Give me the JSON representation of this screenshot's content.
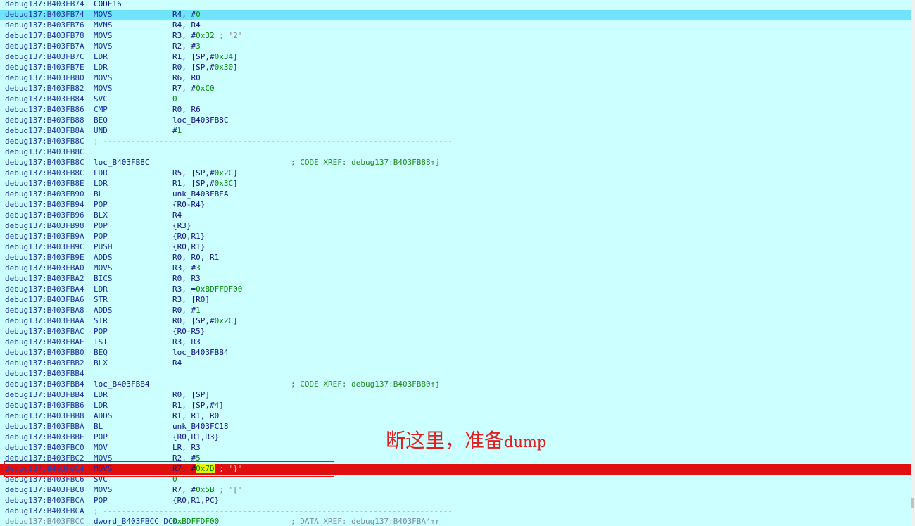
{
  "listing": [
    {
      "addr": "debug137:B403FB74",
      "label": "CODE16"
    },
    {
      "addr": "debug137:B403FB74",
      "mn": "MOVS",
      "ops": [
        [
          "R4, #",
          ""
        ],
        [
          "0",
          "num"
        ]
      ],
      "state": "hl"
    },
    {
      "addr": "debug137:B403FB76",
      "mn": "MVNS",
      "ops": [
        [
          "R4, R4",
          ""
        ]
      ]
    },
    {
      "addr": "debug137:B403FB78",
      "mn": "MOVS",
      "ops": [
        [
          "R3, #",
          ""
        ],
        [
          "0x32",
          "num"
        ],
        [
          " ; '2'",
          "cm"
        ]
      ]
    },
    {
      "addr": "debug137:B403FB7A",
      "mn": "MOVS",
      "ops": [
        [
          "R2, #",
          ""
        ],
        [
          "3",
          "num"
        ]
      ]
    },
    {
      "addr": "debug137:B403FB7C",
      "mn": "LDR",
      "ops": [
        [
          "R1, [SP,#",
          ""
        ],
        [
          "0x34",
          "num"
        ],
        [
          "]",
          ""
        ]
      ]
    },
    {
      "addr": "debug137:B403FB7E",
      "mn": "LDR",
      "ops": [
        [
          "R0, [SP,#",
          ""
        ],
        [
          "0x30",
          "num"
        ],
        [
          "]",
          ""
        ]
      ]
    },
    {
      "addr": "debug137:B403FB80",
      "mn": "MOVS",
      "ops": [
        [
          "R6, R0",
          ""
        ]
      ]
    },
    {
      "addr": "debug137:B403FB82",
      "mn": "MOVS",
      "ops": [
        [
          "R7, #",
          ""
        ],
        [
          "0xC0",
          "num"
        ]
      ]
    },
    {
      "addr": "debug137:B403FB84",
      "mn": "SVC",
      "ops": [
        [
          "0",
          "num"
        ]
      ]
    },
    {
      "addr": "debug137:B403FB86",
      "mn": "CMP",
      "ops": [
        [
          "R0, R6",
          ""
        ]
      ]
    },
    {
      "addr": "debug137:B403FB88",
      "mn": "BEQ",
      "ops": [
        [
          "loc_B403FB8C",
          ""
        ]
      ]
    },
    {
      "addr": "debug137:B403FB8A",
      "mn": "UND",
      "ops": [
        [
          "#",
          ""
        ],
        [
          "1",
          "num"
        ]
      ]
    },
    {
      "addr": "debug137:B403FB8C",
      "sep": "; ---------------------------------------------------------------------------"
    },
    {
      "addr": "debug137:B403FB8C"
    },
    {
      "addr": "debug137:B403FB8C",
      "label": "loc_B403FB8C",
      "xref": "; CODE XREF: debug137:B403FB88↑j"
    },
    {
      "addr": "debug137:B403FB8C",
      "mn": "LDR",
      "ops": [
        [
          "R5, [SP,#",
          ""
        ],
        [
          "0x2C",
          "num"
        ],
        [
          "]",
          ""
        ]
      ]
    },
    {
      "addr": "debug137:B403FB8E",
      "mn": "LDR",
      "ops": [
        [
          "R1, [SP,#",
          ""
        ],
        [
          "0x3C",
          "num"
        ],
        [
          "]",
          ""
        ]
      ]
    },
    {
      "addr": "debug137:B403FB90",
      "mn": "BL",
      "ops": [
        [
          "unk_B403FBEA",
          ""
        ]
      ]
    },
    {
      "addr": "debug137:B403FB94",
      "mn": "POP",
      "ops": [
        [
          "{R0-R4}",
          ""
        ]
      ]
    },
    {
      "addr": "debug137:B403FB96",
      "mn": "BLX",
      "ops": [
        [
          "R4",
          ""
        ]
      ]
    },
    {
      "addr": "debug137:B403FB98",
      "mn": "POP",
      "ops": [
        [
          "{R3}",
          ""
        ]
      ]
    },
    {
      "addr": "debug137:B403FB9A",
      "mn": "POP",
      "ops": [
        [
          "{R0,R1}",
          ""
        ]
      ]
    },
    {
      "addr": "debug137:B403FB9C",
      "mn": "PUSH",
      "ops": [
        [
          "{R0,R1}",
          ""
        ]
      ]
    },
    {
      "addr": "debug137:B403FB9E",
      "mn": "ADDS",
      "ops": [
        [
          "R0, R0, R1",
          ""
        ]
      ]
    },
    {
      "addr": "debug137:B403FBA0",
      "mn": "MOVS",
      "ops": [
        [
          "R3, #",
          ""
        ],
        [
          "3",
          "num"
        ]
      ]
    },
    {
      "addr": "debug137:B403FBA2",
      "mn": "BICS",
      "ops": [
        [
          "R0, R3",
          ""
        ]
      ]
    },
    {
      "addr": "debug137:B403FBA4",
      "mn": "LDR",
      "ops": [
        [
          "R3, =",
          ""
        ],
        [
          "0xBDFFDF00",
          "num"
        ]
      ]
    },
    {
      "addr": "debug137:B403FBA6",
      "mn": "STR",
      "ops": [
        [
          "R3, [R0]",
          ""
        ]
      ]
    },
    {
      "addr": "debug137:B403FBA8",
      "mn": "ADDS",
      "ops": [
        [
          "R0, #",
          ""
        ],
        [
          "1",
          "num"
        ]
      ]
    },
    {
      "addr": "debug137:B403FBAA",
      "mn": "STR",
      "ops": [
        [
          "R0, [SP,#",
          ""
        ],
        [
          "0x2C",
          "num"
        ],
        [
          "]",
          ""
        ]
      ]
    },
    {
      "addr": "debug137:B403FBAC",
      "mn": "POP",
      "ops": [
        [
          "{R0-R5}",
          ""
        ]
      ]
    },
    {
      "addr": "debug137:B403FBAE",
      "mn": "TST",
      "ops": [
        [
          "R3, R3",
          ""
        ]
      ]
    },
    {
      "addr": "debug137:B403FBB0",
      "mn": "BEQ",
      "ops": [
        [
          "loc_B403FBB4",
          ""
        ]
      ]
    },
    {
      "addr": "debug137:B403FBB2",
      "mn": "BLX",
      "ops": [
        [
          "R4",
          ""
        ]
      ]
    },
    {
      "addr": "debug137:B403FBB4"
    },
    {
      "addr": "debug137:B403FBB4",
      "label": "loc_B403FBB4",
      "xref": "; CODE XREF: debug137:B403FBB0↑j"
    },
    {
      "addr": "debug137:B403FBB4",
      "mn": "LDR",
      "ops": [
        [
          "R0, [SP]",
          ""
        ]
      ]
    },
    {
      "addr": "debug137:B403FBB6",
      "mn": "LDR",
      "ops": [
        [
          "R1, [SP,#",
          ""
        ],
        [
          "4",
          "num"
        ],
        [
          "]",
          ""
        ]
      ]
    },
    {
      "addr": "debug137:B403FBB8",
      "mn": "ADDS",
      "ops": [
        [
          "R1, R1, R0",
          ""
        ]
      ]
    },
    {
      "addr": "debug137:B403FBBA",
      "mn": "BL",
      "ops": [
        [
          "unk_B403FC18",
          ""
        ]
      ]
    },
    {
      "addr": "debug137:B403FBBE",
      "mn": "POP",
      "ops": [
        [
          "{R0,R1,R3}",
          ""
        ]
      ]
    },
    {
      "addr": "debug137:B403FBC0",
      "mn": "MOV",
      "ops": [
        [
          "LR, R3",
          ""
        ]
      ]
    },
    {
      "addr": "debug137:B403FBC2",
      "mn": "MOVS",
      "ops": [
        [
          "R2, #",
          ""
        ],
        [
          "5",
          "num"
        ]
      ]
    },
    {
      "addr": "debug137:B403FBC4",
      "mn": "MOVS",
      "ops": [
        [
          "R7, #",
          ""
        ],
        [
          "0x7D",
          "imm-hl"
        ],
        [
          " ; '}'",
          "cm"
        ]
      ],
      "state": "bp"
    },
    {
      "addr": "debug137:B403FBC6",
      "mn": "SVC",
      "ops": [
        [
          "0",
          "num"
        ]
      ]
    },
    {
      "addr": "debug137:B403FBC8",
      "mn": "MOVS",
      "ops": [
        [
          "R7, #",
          ""
        ],
        [
          "0x5B",
          "num"
        ],
        [
          " ; '['",
          "cm"
        ]
      ]
    },
    {
      "addr": "debug137:B403FBCA",
      "mn": "POP",
      "ops": [
        [
          "{R0,R1,PC}",
          ""
        ]
      ]
    },
    {
      "addr": "debug137:B403FBCA",
      "sep": "; ---------------------------------------------------------------------------"
    },
    {
      "addr": "debug137:B403FBCC",
      "mn": "dword_B403FBCC DCD",
      "ops": [
        [
          "0xBDFFDF00",
          "num"
        ]
      ],
      "xref": "; DATA XREF: debug137:B403FBA4↑r",
      "dim": true
    }
  ],
  "annotation": {
    "cjk": "断这里，准备",
    "latin": "dump"
  },
  "colors": {
    "background": "#ccffff",
    "current_line": "#70e4fa",
    "breakpoint_line": "#e01010",
    "note": "#e02020"
  }
}
